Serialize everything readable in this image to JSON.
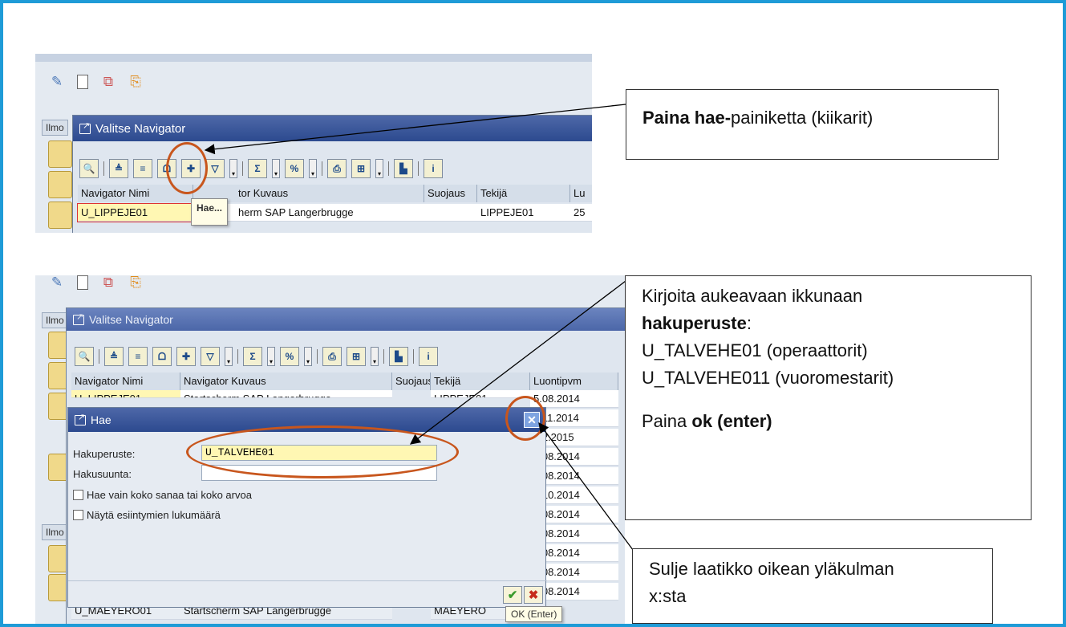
{
  "top_screen": {
    "dialog_title": "Valitse Navigator",
    "tab_label": "Ilmo",
    "tooltip": "Hae...",
    "columns": [
      "Navigator Nimi",
      "tor Kuvaus",
      "Suojaus",
      "Tekijä",
      "Lu"
    ],
    "row": {
      "name": "U_LIPPEJE01",
      "desc": "herm SAP Langerbrugge",
      "protect": "",
      "author": "LIPPEJE01",
      "date": "25"
    }
  },
  "bottom_screen": {
    "dialog_title": "Valitse Navigator",
    "tab_label_1": "Ilmo",
    "tab_label_2": "Ilmo",
    "columns": [
      "Navigator Nimi",
      "Navigator Kuvaus",
      "Suojaus",
      "Tekijä",
      "Luontipvm"
    ],
    "first_row": {
      "name": "U_LIPPEJE01",
      "desc": "Startscherm SAP Langerbrugge",
      "author": "LIPPEJE01",
      "date": "5.08.2014"
    },
    "dates": [
      "7.11.2014",
      ".02.2015",
      "5.08.2014",
      "5.08.2014",
      "5.10.2014",
      "5.08.2014",
      "5.08.2014",
      "5.08.2014",
      "5.08.2014",
      "5.08.2014"
    ],
    "last_row": {
      "name": "U_MAEYERO01",
      "desc": "Startscherm SAP Langerbrugge",
      "author": "MAEYERO"
    },
    "ok_tooltip": "OK   (Enter)",
    "search_dialog": {
      "title": "Hae",
      "label_criteria": "Hakuperuste:",
      "value_criteria": "U_TALVEHE01",
      "label_direction": "Hakusuunta:",
      "value_direction": "",
      "check_whole_word": "Hae vain koko sanaa tai koko arvoa",
      "check_show_count": "Näytä esiintymien lukumäärä"
    }
  },
  "callouts": {
    "c1": {
      "bold": "Paina hae-",
      "rest": "painiketta (kiikarit)"
    },
    "c2": {
      "line1": "Kirjoita aukeavaan ikkunaan",
      "line2_bold": "hakuperuste",
      "line2_rest": ":",
      "line3": "U_TALVEHE01 (operaattorit)",
      "line4": "U_TALVEHE011 (vuoromestarit)",
      "line5_pre": "Paina ",
      "line5_bold": "ok (enter)"
    },
    "c3": {
      "line1": "Sulje laatikko oikean yläkulman",
      "line2": "x:sta"
    }
  },
  "colors": {
    "frame": "#1e9bd7",
    "ellipse": "#c8561d",
    "sap_title": "#2c4a8f"
  }
}
